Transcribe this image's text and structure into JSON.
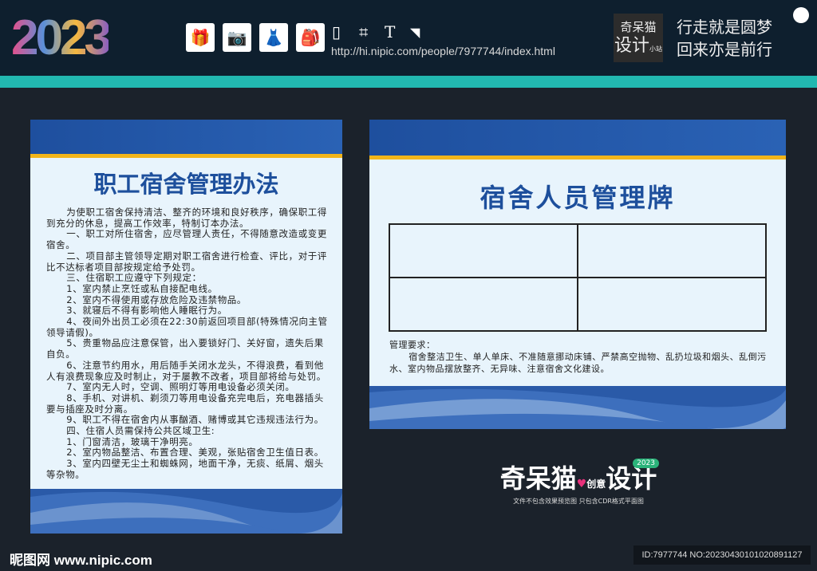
{
  "header": {
    "logo_year": "2023",
    "url": "http://hi.nipic.com/people/7977744/index.html",
    "brand_line1": "奇呆猫",
    "brand_line2": "设计",
    "brand_small": "小站",
    "slogan1": "行走就是圆梦",
    "slogan2": "回来亦是前行",
    "icons": [
      "gift-icon",
      "camera-icon",
      "dress-icon",
      "backpack-icon"
    ],
    "tools": [
      "rectangle-icon",
      "crop-icon",
      "text-icon",
      "page-icon"
    ]
  },
  "left_panel": {
    "title": "职工宿舍管理办法",
    "paragraphs": [
      "为使职工宿舍保持清洁、整齐的环境和良好秩序，确保职工得到充分的休息，提高工作效率，特制订本办法。",
      "一、职工对所住宿舍，应尽管理人责任，不得随意改造或变更宿舍。",
      "二、项目部主管领导定期对职工宿舍进行检查、评比，对于评比不达标者项目部按规定给予处罚。",
      "三、住宿职工应遵守下列规定：",
      "1、室内禁止烹饪或私自接配电线。",
      "2、室内不得使用或存放危险及违禁物品。",
      "3、就寝后不得有影响他人睡眠行为。",
      "4、夜间外出员工必须在22:30前返回项目部(特殊情况向主管领导请假)。",
      "5、贵重物品应注意保管，出入要锁好门、关好窗，遗失后果自负。",
      "6、注意节约用水，用后随手关闭水龙头，不得浪费，看到他人有浪费现象应及时制止，对于屡教不改者，项目部将给与处罚。",
      "7、室内无人时，空调、照明灯等用电设备必须关闭。",
      "8、手机、对讲机、剃须刀等用电设备充完电后，充电器插头要与插座及时分离。",
      "9、职工不得在宿舍内从事酗酒、赌博或其它违规违法行为。",
      "四、住宿人员需保持公共区域卫生:",
      "1、门窗清洁，玻璃干净明亮。",
      "2、室内物品整洁、布置合理、美观，张贴宿舍卫生值日表。",
      "3、室内四壁无尘土和蜘蛛网，地面干净，无痰、纸屑、烟头等杂物。"
    ]
  },
  "right_panel": {
    "title": "宿舍人员管理牌",
    "req_label": "管理要求：",
    "req_text": "宿舍整洁卫生、单人单床、不准随意挪动床铺、严禁高空抛物、乱扔垃圾和烟头、乱倒污水、室内物品摆放整齐、无异味、注意宿舍文化建设。"
  },
  "watermark": {
    "name1": "奇呆猫",
    "name2": "创意",
    "name3": "设计",
    "badge": "2023",
    "sub": "文件不包含效果预览图  只包含CDR格式平面图"
  },
  "footer": {
    "site": "昵图网 www.nipic.com",
    "id": "ID:7977744 NO:20230430101020891127"
  },
  "colors": {
    "header": "#0e1f2e",
    "teal": "#22b8b0",
    "blue": "#1e4f9e",
    "yellow": "#f2b51a",
    "panel": "#e8f4fc"
  }
}
